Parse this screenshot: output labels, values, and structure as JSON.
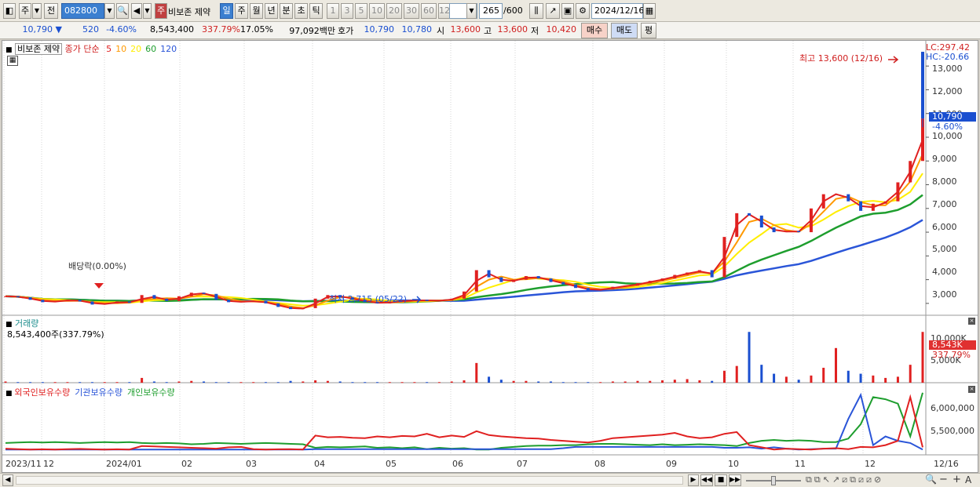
{
  "toolbar": {
    "type_label": "주",
    "prev_label": "전",
    "code_value": "082800",
    "stock_name": "비보존 제약",
    "period_buttons": [
      "일",
      "주",
      "월",
      "년",
      "분",
      "초",
      "틱"
    ],
    "interval_buttons": [
      "1",
      "3",
      "5",
      "10",
      "20",
      "30",
      "60",
      "120"
    ],
    "count_value": "265",
    "count_max": "/600",
    "date_value": "2024/12/16"
  },
  "quote": {
    "price": "10,790 ▼",
    "change": "520",
    "change_pct": "-4.60%",
    "volume": "8,543,400",
    "volume_ratio": "337.79%",
    "turnover": "17.05%",
    "amount": "97,092백만",
    "bid_label": "호가",
    "ask": "10,790",
    "bid": "10,780",
    "open_label": "시",
    "open": "13,600",
    "high_label": "고",
    "high": "13,600",
    "low_label": "저",
    "low": "10,420",
    "buy_label": "매수",
    "sell_label": "매도",
    "eval_label": "평"
  },
  "price_panel": {
    "title": "비보존 제약",
    "ma_label": "종가 단순",
    "ma_periods": [
      "5",
      "10",
      "20",
      "60",
      "120"
    ],
    "ma_colors": [
      "#e02020",
      "#ff9900",
      "#ffee00",
      "#1e9e2e",
      "#2a55d8"
    ],
    "lc": "LC:297.42",
    "hc": "HC:-20.66",
    "high_annotation": "최고 13,600 (12/16)",
    "low_annotation": "최저 2,715 (05/22)",
    "dividend_annotation": "배당락(0.00%)",
    "y_ticks": [
      "13,000",
      "12,000",
      "11,000",
      "10,000",
      "9,000",
      "8,000",
      "7,000",
      "6,000",
      "5,000",
      "4,000",
      "3,000"
    ],
    "current_price": "10,790",
    "current_pct": "-4.60%"
  },
  "volume_panel": {
    "title": "거래량",
    "value": "8,543,400주(337.79%)",
    "y_ticks": [
      "10,000K",
      "5,000K"
    ],
    "current": "8,543K",
    "current_pct": "337.79%"
  },
  "holding_panel": {
    "series": [
      {
        "name": "외국인보유수량",
        "color": "#e02020"
      },
      {
        "name": "기관보유수량",
        "color": "#2a55d8"
      },
      {
        "name": "개인보유수량",
        "color": "#1e9e2e"
      }
    ],
    "y_ticks": [
      "6,000,000",
      "5,500,000"
    ]
  },
  "x_axis": [
    "2023/11",
    "12",
    "2024/01",
    "02",
    "03",
    "04",
    "05",
    "06",
    "07",
    "08",
    "09",
    "10",
    "11",
    "12"
  ],
  "x_axis_end": "12/16",
  "chart_data": {
    "type": "candlestick",
    "price_ylim": [
      2500,
      13800
    ],
    "closes": [
      3300,
      3260,
      3150,
      3050,
      3100,
      3150,
      3080,
      2950,
      3000,
      3080,
      3020,
      3350,
      3200,
      3100,
      3300,
      3450,
      3400,
      3150,
      3050,
      3080,
      3100,
      3000,
      2850,
      2760,
      2800,
      3200,
      3350,
      3250,
      3150,
      3050,
      3000,
      3080,
      3100,
      3150,
      3100,
      3120,
      3200,
      3500,
      4400,
      4100,
      3900,
      4000,
      4150,
      4050,
      3900,
      3800,
      3650,
      3550,
      3600,
      3700,
      3750,
      3850,
      3950,
      4050,
      4200,
      4300,
      4400,
      4100,
      5800,
      6800,
      6700,
      6200,
      6000,
      6050,
      6000,
      7000,
      7600,
      7600,
      7300,
      6900,
      7200,
      7300,
      8100,
      9000,
      10790
    ],
    "volume_millions": [
      0.2,
      0.1,
      0.1,
      0.1,
      0.1,
      0.1,
      0.1,
      0.1,
      0.1,
      0.1,
      0.1,
      0.8,
      0.2,
      0.1,
      0.2,
      0.3,
      0.2,
      0.1,
      0.1,
      0.1,
      0.1,
      0.1,
      0.1,
      0.3,
      0.2,
      0.4,
      0.3,
      0.2,
      0.1,
      0.1,
      0.1,
      0.1,
      0.1,
      0.1,
      0.1,
      0.1,
      0.2,
      0.4,
      3.3,
      1.0,
      0.5,
      0.3,
      0.3,
      0.2,
      0.2,
      0.1,
      0.1,
      0.1,
      0.1,
      0.2,
      0.2,
      0.3,
      0.3,
      0.4,
      0.5,
      0.6,
      0.4,
      0.3,
      2.0,
      2.8,
      8.5,
      3.0,
      1.5,
      1.0,
      0.5,
      1.2,
      2.5,
      5.8,
      2.0,
      1.5,
      1.2,
      0.8,
      1.0,
      3.0,
      8.5
    ],
    "foreign_holding": [
      5020,
      5010,
      5000,
      5005,
      5000,
      5010,
      5015,
      5005,
      5000,
      5005,
      5000,
      5080,
      5070,
      5060,
      5050,
      5040,
      5030,
      5020,
      5050,
      5060,
      5010,
      5000,
      5005,
      5010,
      5000,
      5320,
      5280,
      5290,
      5270,
      5260,
      5300,
      5280,
      5310,
      5300,
      5360,
      5280,
      5320,
      5290,
      5420,
      5330,
      5300,
      5280,
      5260,
      5250,
      5220,
      5200,
      5180,
      5160,
      5200,
      5260,
      5280,
      5300,
      5320,
      5340,
      5380,
      5300,
      5260,
      5280,
      5360,
      5400,
      5100,
      5050,
      5000,
      5020,
      5010,
      5000,
      5020,
      5030,
      5010,
      5060,
      5050,
      5100,
      5200,
      6200,
      5050
    ],
    "institution_holding": [
      5000,
      5000,
      5000,
      5000,
      5000,
      5000,
      5000,
      5000,
      5000,
      5000,
      5000,
      5000,
      5000,
      5000,
      5000,
      5000,
      5000,
      5000,
      5000,
      5000,
      5000,
      5000,
      5000,
      5000,
      5000,
      5010,
      5010,
      5010,
      5010,
      5010,
      5010,
      5010,
      5010,
      5010,
      5010,
      5010,
      5010,
      5010,
      5010,
      5010,
      5010,
      5010,
      5010,
      5010,
      5010,
      5030,
      5060,
      5060,
      5060,
      5060,
      5060,
      5060,
      5060,
      5060,
      5060,
      5060,
      5060,
      5060,
      5040,
      5040,
      5050,
      5020,
      5050,
      5020,
      5000,
      5010,
      5020,
      5020,
      5700,
      6250,
      5100,
      5300,
      5200,
      5150,
      5000
    ],
    "individual_holding": [
      5150,
      5160,
      5170,
      5160,
      5170,
      5160,
      5150,
      5160,
      5170,
      5160,
      5170,
      5150,
      5140,
      5150,
      5140,
      5120,
      5130,
      5150,
      5140,
      5130,
      5140,
      5150,
      5140,
      5130,
      5120,
      5040,
      5060,
      5050,
      5060,
      5070,
      5040,
      5050,
      5030,
      5050,
      5010,
      5040,
      5020,
      5030,
      5000,
      5000,
      5040,
      5060,
      5080,
      5090,
      5090,
      5100,
      5100,
      5120,
      5130,
      5130,
      5120,
      5110,
      5100,
      5120,
      5100,
      5110,
      5120,
      5110,
      5100,
      5080,
      5150,
      5200,
      5220,
      5200,
      5210,
      5200,
      5170,
      5170,
      5250,
      5580,
      6200,
      6150,
      6050,
      5300,
      6300
    ]
  }
}
